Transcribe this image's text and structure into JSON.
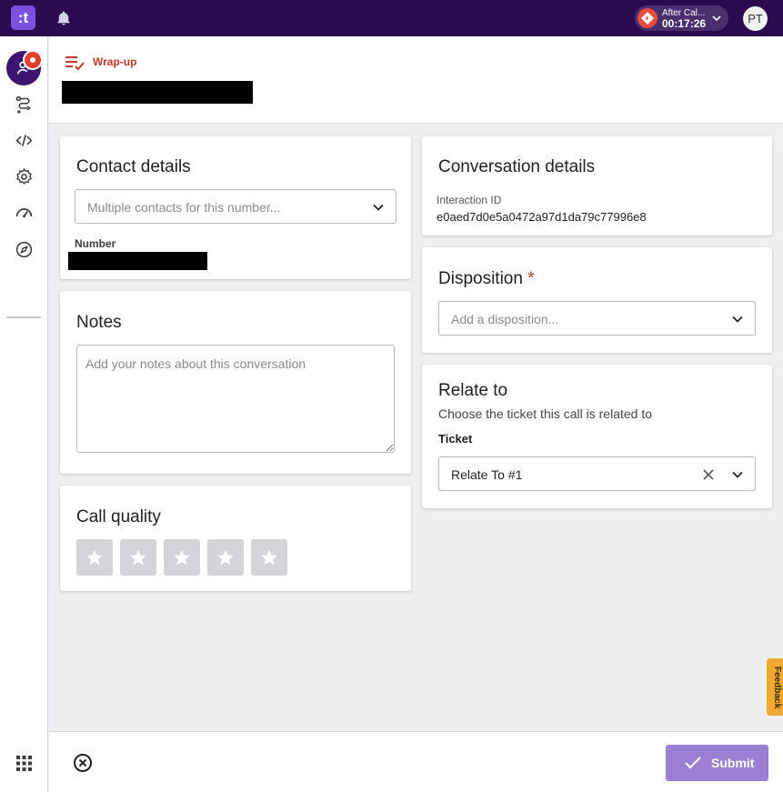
{
  "topbar": {
    "logo_text": ":t",
    "status_label": "After Cal...",
    "status_timer": "00:17:26",
    "avatar_initials": "PT"
  },
  "header": {
    "section_label": "Wrap-up"
  },
  "contact": {
    "title": "Contact details",
    "select_placeholder": "Multiple contacts for this number...",
    "number_label": "Number"
  },
  "notes": {
    "title": "Notes",
    "placeholder": "Add your notes about this conversation"
  },
  "call_quality": {
    "title": "Call quality",
    "rating": 0,
    "max": 5
  },
  "conversation": {
    "title": "Conversation details",
    "interaction_id_label": "Interaction ID",
    "interaction_id": "e0aed7d0e5a0472a97d1da79c77996e8"
  },
  "disposition": {
    "title": "Disposition",
    "required_mark": "*",
    "placeholder": "Add a disposition..."
  },
  "relate": {
    "title": "Relate to",
    "subtitle": "Choose the ticket this call is related to",
    "ticket_label": "Ticket",
    "ticket_value": "Relate To #1"
  },
  "feedback": {
    "label": "Feedback"
  },
  "footer": {
    "submit_label": "Submit"
  },
  "colors": {
    "topbar": "#2c0a4f",
    "accent": "#7b4fe0",
    "submit": "#9b7fd3",
    "required": "#d03a2b",
    "feedback": "#f0a830"
  }
}
